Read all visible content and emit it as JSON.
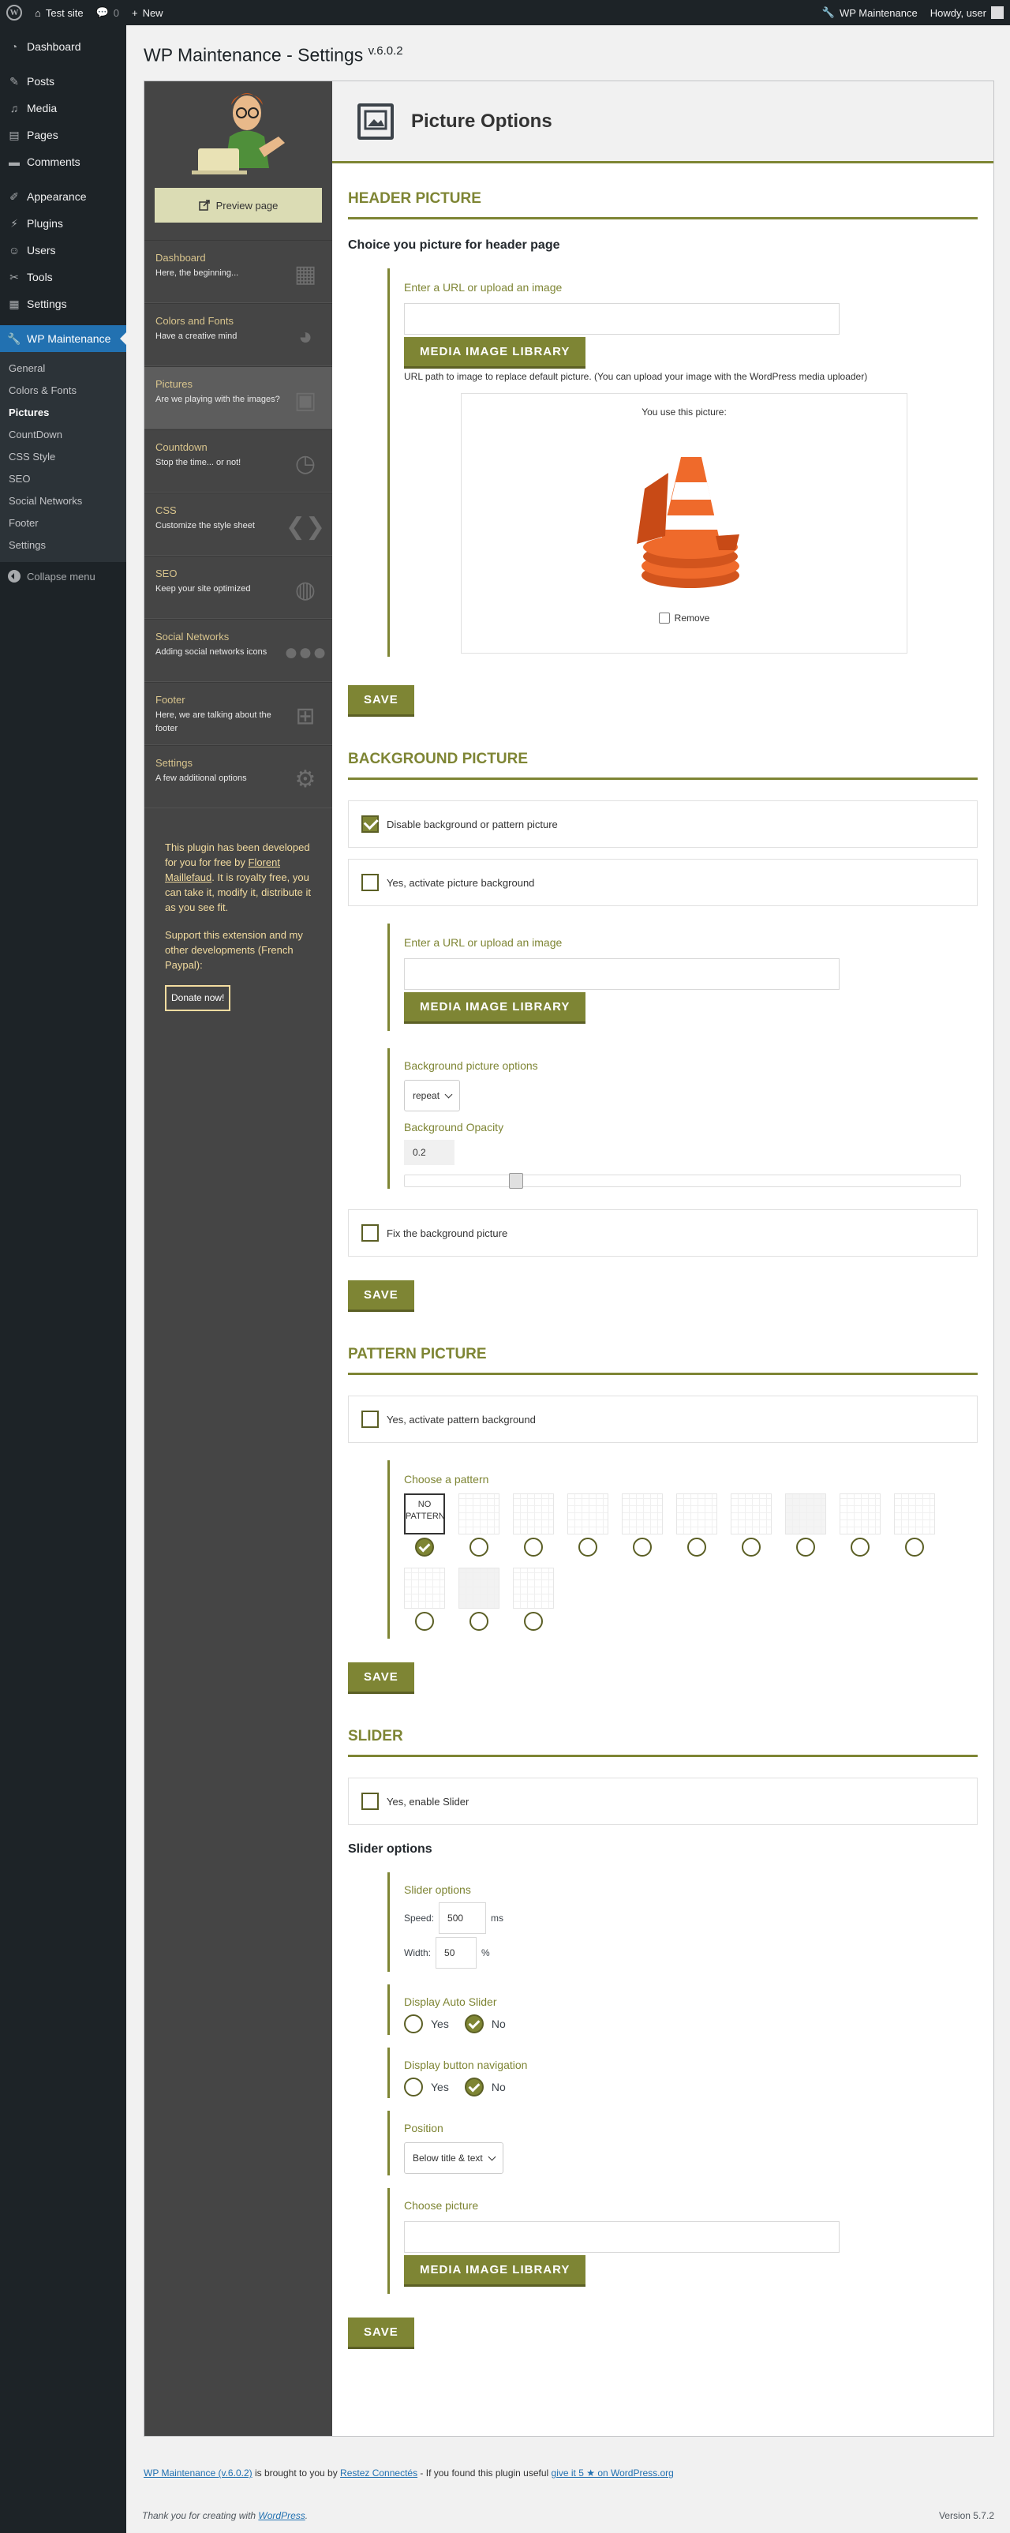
{
  "adminbar": {
    "site_name": "Test site",
    "comments_count": "0",
    "new_label": "New",
    "plugin_label": "WP Maintenance",
    "howdy": "Howdy, user"
  },
  "admin_menu": {
    "items": [
      {
        "label": "Dashboard",
        "icon": "dashboard-icon"
      },
      {
        "label": "Posts",
        "icon": "pin-icon"
      },
      {
        "label": "Media",
        "icon": "media-icon"
      },
      {
        "label": "Pages",
        "icon": "pages-icon"
      },
      {
        "label": "Comments",
        "icon": "comments-icon"
      },
      {
        "label": "Appearance",
        "icon": "brush-icon"
      },
      {
        "label": "Plugins",
        "icon": "plug-icon"
      },
      {
        "label": "Users",
        "icon": "users-icon"
      },
      {
        "label": "Tools",
        "icon": "wrench-icon"
      },
      {
        "label": "Settings",
        "icon": "settings-icon"
      }
    ],
    "current": "WP Maintenance",
    "submenu": [
      "General",
      "Colors & Fonts",
      "Pictures",
      "CountDown",
      "CSS Style",
      "SEO",
      "Social Networks",
      "Footer",
      "Settings"
    ],
    "collapse_label": "Collapse menu"
  },
  "page": {
    "title": "WP Maintenance - Settings",
    "version": "v.6.0.2"
  },
  "plugin_sidebar": {
    "preview_label": "Preview page",
    "nav": [
      {
        "title": "Dashboard",
        "desc": "Here, the beginning..."
      },
      {
        "title": "Colors and Fonts",
        "desc": "Have a creative mind"
      },
      {
        "title": "Pictures",
        "desc": "Are we playing with the images?"
      },
      {
        "title": "Countdown",
        "desc": "Stop the time... or not!"
      },
      {
        "title": "CSS",
        "desc": "Customize the style sheet"
      },
      {
        "title": "SEO",
        "desc": "Keep your site optimized"
      },
      {
        "title": "Social Networks",
        "desc": "Adding social networks icons"
      },
      {
        "title": "Footer",
        "desc": "Here, we are talking about the footer"
      },
      {
        "title": "Settings",
        "desc": "A few additional options"
      }
    ],
    "credit_1a": "This plugin has been developed for you for free by ",
    "credit_author": "Florent Maillefaud",
    "credit_1b": ". It is royalty free, you can take it, modify it, distribute it as you see fit.",
    "credit_2": "Support this extension and my other developments (French Paypal):",
    "donate_label": "Donate now!"
  },
  "main": {
    "heading": "Picture Options",
    "header_picture": {
      "title": "HEADER PICTURE",
      "subtitle": "Choice you picture for header page",
      "field_label": "Enter a URL or upload an image",
      "media_button": "MEDIA IMAGE LIBRARY",
      "helper": "URL path to image to replace default picture. (You can upload your image with the WordPress media uploader)",
      "preview_label": "You use this picture:",
      "remove_label": "Remove",
      "save": "SAVE"
    },
    "background_picture": {
      "title": "BACKGROUND PICTURE",
      "disable_label": "Disable background or pattern picture",
      "activate_label": "Yes, activate picture background",
      "field_label": "Enter a URL or upload an image",
      "media_button": "MEDIA IMAGE LIBRARY",
      "options_label": "Background picture options",
      "repeat_value": "repeat",
      "opacity_label": "Background Opacity",
      "opacity_value": "0.2",
      "fix_label": "Fix the background picture",
      "save": "SAVE"
    },
    "pattern_picture": {
      "title": "PATTERN PICTURE",
      "activate_label": "Yes, activate pattern background",
      "choose_label": "Choose a pattern",
      "no_pattern_label": "NO PATTERN",
      "save": "SAVE"
    },
    "slider": {
      "title": "SLIDER",
      "enable_label": "Yes, enable Slider",
      "subtitle": "Slider options",
      "options_label": "Slider options",
      "speed_label": "Speed:",
      "speed_value": "500",
      "speed_unit": "ms",
      "width_label": "Width:",
      "width_value": "50",
      "width_unit": "%",
      "auto_label": "Display Auto Slider",
      "nav_label": "Display button navigation",
      "yes": "Yes",
      "no": "No",
      "position_label": "Position",
      "position_value": "Below title & text",
      "choose_picture_label": "Choose picture",
      "media_button": "MEDIA IMAGE LIBRARY",
      "save": "SAVE"
    }
  },
  "footer": {
    "link1": "WP Maintenance (v.6.0.2)",
    "text1": " is brought to you by ",
    "link2": "Restez Connectés",
    "text2": " - If you found this plugin useful ",
    "link3": "give it 5 ★ on WordPress.org",
    "thanks": "Thank you for creating with ",
    "wp_link": "WordPress",
    "version": "Version 5.7.2"
  }
}
